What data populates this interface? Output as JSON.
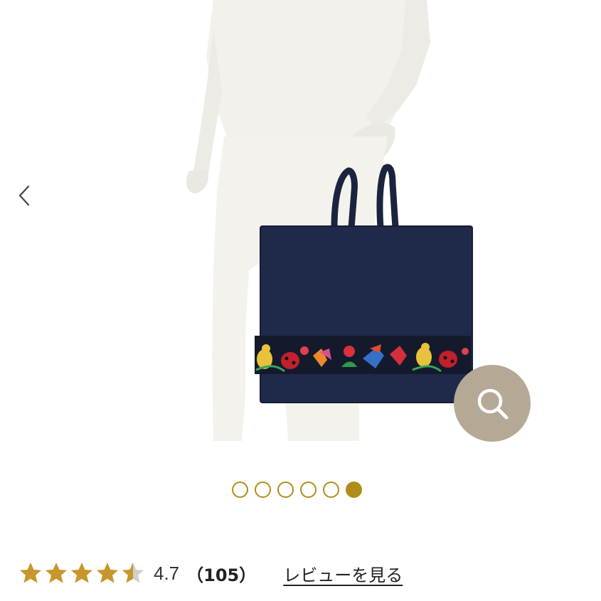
{
  "gallery": {
    "image_alt": "product photo: navy tote bag carried by mannequin",
    "nav": {
      "prev_icon": "chevron-left-icon",
      "zoom_icon": "magnifier-icon"
    },
    "dots": {
      "count": 6,
      "active_index": 5
    },
    "colors": {
      "accent": "#b08d1a",
      "zoom_bg": "#b5a895",
      "bag": "#1f2a4a"
    }
  },
  "rating": {
    "stars_value": 4.7,
    "stars_max": 5,
    "value_label": "4.7",
    "count_label": "（105）",
    "review_link_label": "レビューを見る",
    "star_color": "#c8962a",
    "star_empty_color": "#cfcfcf"
  }
}
